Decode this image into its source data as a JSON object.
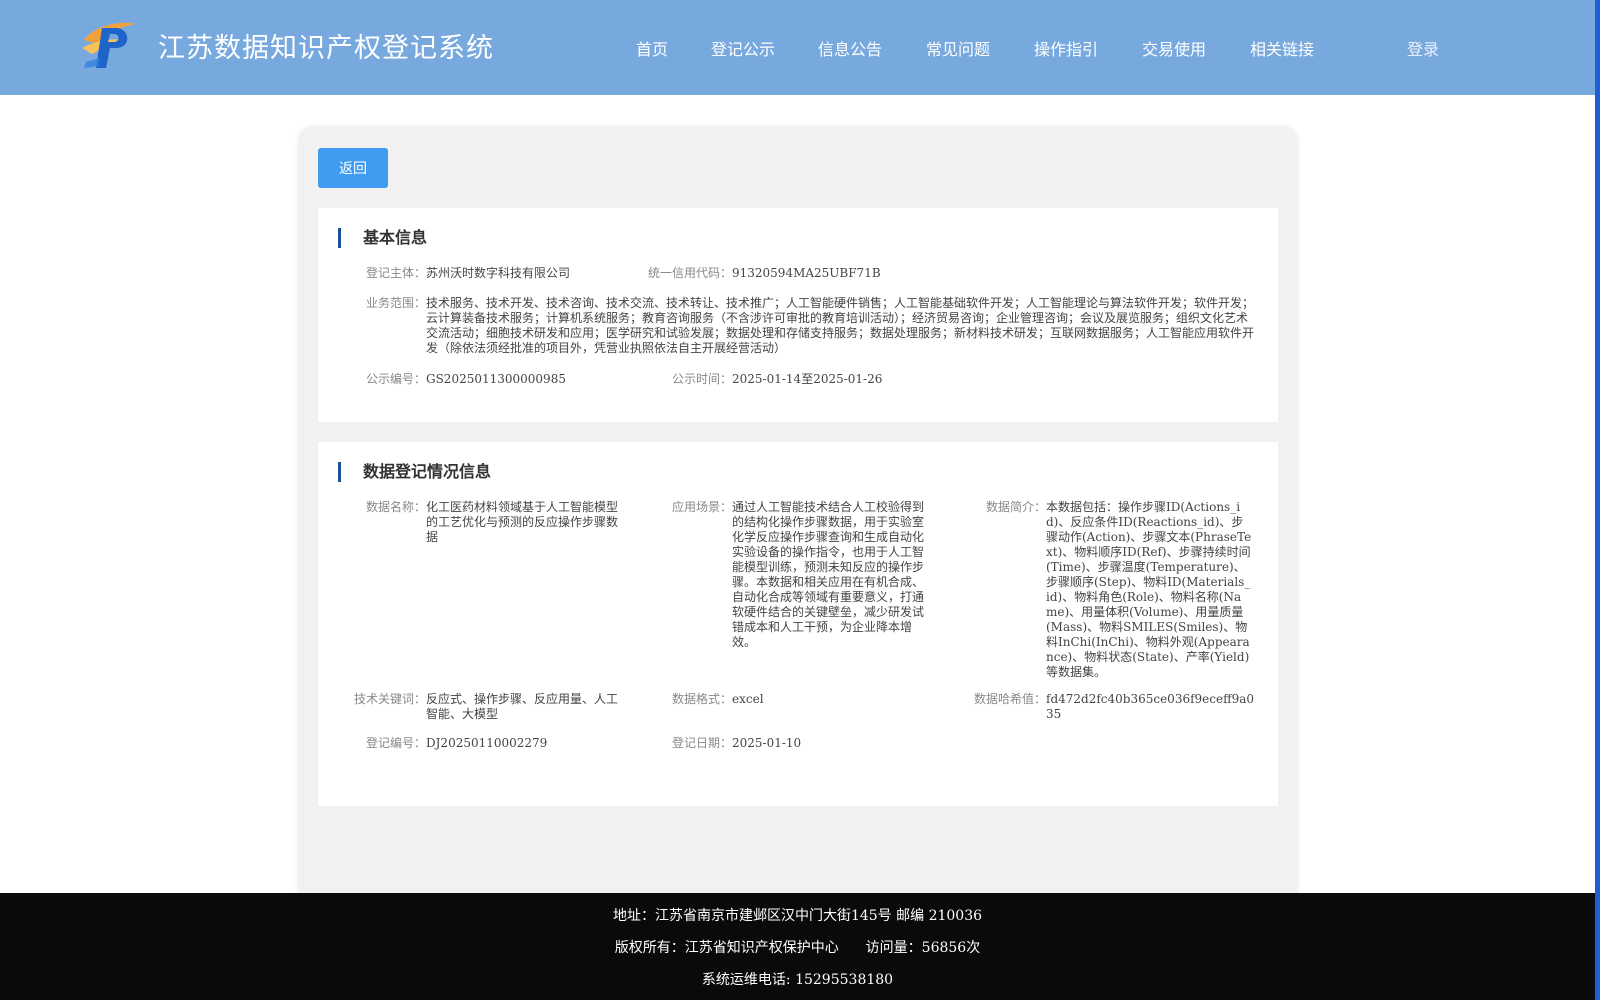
{
  "header": {
    "title": "江苏数据知识产权登记系统",
    "nav": [
      "首页",
      "登记公示",
      "信息公告",
      "常见问题",
      "操作指引",
      "交易使用",
      "相关链接"
    ],
    "login": "登录"
  },
  "back_label": "返回",
  "basic": {
    "title": "基本信息",
    "subject_label": "登记主体：",
    "subject": "苏州沃时数字科技有限公司",
    "credit_label": "统一信用代码：",
    "credit": "91320594MA25UBF71B",
    "scope_label": "业务范围：",
    "scope": "技术服务、技术开发、技术咨询、技术交流、技术转让、技术推广；人工智能硬件销售；人工智能基础软件开发；人工智能理论与算法软件开发；软件开发；云计算装备技术服务；计算机系统服务；教育咨询服务（不含涉许可审批的教育培训活动）；经济贸易咨询；企业管理咨询；会议及展览服务；组织文化艺术交流活动；细胞技术研发和应用；医学研究和试验发展；数据处理和存储支持服务；数据处理服务；新材料技术研发；互联网数据服务；人工智能应用软件开发（除依法须经批准的项目外，凭营业执照依法自主开展经营活动）",
    "pub_no_label": "公示编号：",
    "pub_no": "GS2025011300000985",
    "pub_time_label": "公示时间：",
    "pub_time": "2025-01-14至2025-01-26"
  },
  "data": {
    "title": "数据登记情况信息",
    "name_label": "数据名称：",
    "name": "化工医药材料领域基于人工智能模型的工艺优化与预测的反应操作步骤数据",
    "scene_label": "应用场景：",
    "scene": "通过人工智能技术结合人工校验得到的结构化操作步骤数据，用于实验室化学反应操作步骤查询和生成自动化实验设备的操作指令，也用于人工智能模型训练，预测未知反应的操作步骤。本数据和相关应用在有机合成、自动化合成等领域有重要意义，打通软硬件结合的关键壁垒，减少研发试错成本和人工干预，为企业降本增效。",
    "intro_label": "数据简介：",
    "intro": "本数据包括：操作步骤ID(Actions_id)、反应条件ID(Reactions_id)、步骤动作(Action)、步骤文本(PhraseText)、物料顺序ID(Ref)、步骤持续时间(Time)、步骤温度(Temperature)、步骤顺序(Step)、物料ID(Materials_id)、物料角色(Role)、物料名称(Name)、用量体积(Volume)、用量质量(Mass)、物料SMILES(Smiles)、物料InChi(InChi)、物料外观(Appearance)、物料状态(State)、产率(Yield)等数据集。",
    "keywords_label": "技术关键词：",
    "keywords": "反应式、操作步骤、反应用量、人工智能、大模型",
    "format_label": "数据格式：",
    "format": "excel",
    "hash_label": "数据哈希值：",
    "hash": "fd472d2fc40b365ce036f9eceff9a035",
    "reg_no_label": "登记编号：",
    "reg_no": "DJ20250110002279",
    "reg_date_label": "登记日期：",
    "reg_date": "2025-01-10"
  },
  "footer": {
    "address": "地址：江苏省南京市建邺区汉中门大街145号 邮编 210036",
    "copyright": "版权所有：江苏省知识产权保护中心",
    "visits": "访问量：56856次",
    "phone": "系统运维电话: 15295538180"
  },
  "colors": {
    "header_bg": "#78a9de",
    "button_bg": "#3f9cf0",
    "footer_bg": "#0a0a0a"
  }
}
